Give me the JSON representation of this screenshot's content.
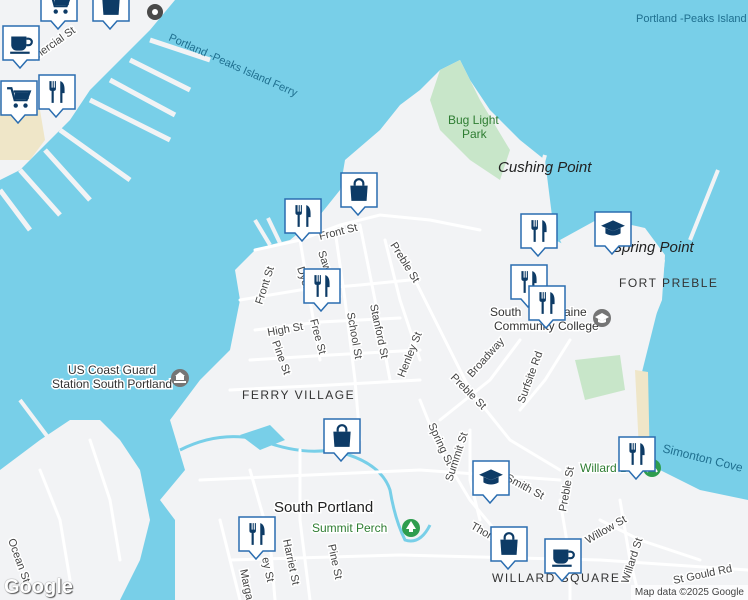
{
  "streets": {
    "front_st": "Front St",
    "front_st_2": "Front St",
    "dyer_st": "Dyer St",
    "sawyer_st": "Sawyer St",
    "preble_st": "Preble St",
    "high_st": "High St",
    "free_st": "Free St",
    "school_st": "School St",
    "stanford_st": "Stanford St",
    "henley_st": "Henley St",
    "pine_st": "Pine St",
    "pine_st_2": "Pine St",
    "broadway": "Broadway",
    "preble_st_2": "Preble St",
    "surfsite_rd": "Surfsite Rd",
    "spring_st": "Spring St",
    "summit_st": "Summit St",
    "smith_st": "Smith St",
    "preble_st_3": "Preble St",
    "willow_st": "Willow St",
    "willard_st": "Willard St",
    "gould_rd": "St Gould Rd",
    "ocean_st": "Ocean St",
    "harriet_st": "Harriet St",
    "margaret": "Marga",
    "thon": "Thon",
    "commercial_st": "mercial St",
    "ey_st": "ey St"
  },
  "places": {
    "ferry": "Portland -Peaks Island Ferry",
    "ferry_top": "Portland -Peaks Island",
    "bug_light_1": "Bug Light",
    "bug_light_2": "Park",
    "cushing_point": "Cushing Point",
    "spring_point": "Spring Point",
    "fort_preble": "FORT PREBLE",
    "college_1": "Southern Maine",
    "college_1_visible": "South",
    "college_1_tail": "aine",
    "college_2": "Community College",
    "coast_guard_1": "US Coast Guard",
    "coast_guard_2": "Station South Portland",
    "ferry_village": "FERRY VILLAGE",
    "south_portland": "South Portland",
    "summit_perch": "Summit Perch",
    "willard_beach": "Willard Bea",
    "simonton_cove": "Simonton Cove",
    "willard_square": "WILLARD SQUARE"
  },
  "markers": [
    {
      "name": "restaurant-marker-front-st",
      "icon": "restaurant-icon"
    },
    {
      "name": "shopping-marker-front-st",
      "icon": "shopping-bag-icon"
    },
    {
      "name": "restaurant-marker-sawyer-st",
      "icon": "restaurant-icon"
    },
    {
      "name": "restaurant-marker-ferry-terminal",
      "icon": "restaurant-icon"
    },
    {
      "name": "grocery-marker-ferry-terminal",
      "icon": "grocery-cart-icon"
    },
    {
      "name": "cafe-marker-top-left",
      "icon": "coffee-cup-icon"
    },
    {
      "name": "grocery-marker-top-left",
      "icon": "grocery-cart-icon"
    },
    {
      "name": "shopping-marker-top-left",
      "icon": "shopping-bag-icon"
    },
    {
      "name": "restaurant-marker-college-1",
      "icon": "restaurant-icon"
    },
    {
      "name": "restaurant-marker-college-2",
      "icon": "restaurant-icon"
    },
    {
      "name": "restaurant-marker-college-3",
      "icon": "restaurant-icon"
    },
    {
      "name": "school-marker-spring-point",
      "icon": "graduation-cap-icon"
    },
    {
      "name": "shopping-marker-ferry-village",
      "icon": "shopping-bag-icon"
    },
    {
      "name": "school-marker-summit-st",
      "icon": "graduation-cap-icon"
    },
    {
      "name": "restaurant-marker-willard-beach",
      "icon": "restaurant-icon"
    },
    {
      "name": "restaurant-marker-south-portland",
      "icon": "restaurant-icon"
    },
    {
      "name": "shopping-marker-willard-square",
      "icon": "shopping-bag-icon"
    },
    {
      "name": "cafe-marker-willard-square",
      "icon": "coffee-cup-icon"
    }
  ],
  "footer": {
    "logo": "Google",
    "attribution": "Map data ©2025 Google"
  },
  "colors": {
    "water": "#78cfe8",
    "land": "#f2f3f5",
    "park": "#c8e6c9",
    "marker_fill": "#ffffff",
    "marker_border": "#2a6db0",
    "marker_icon": "#0d3b66"
  }
}
